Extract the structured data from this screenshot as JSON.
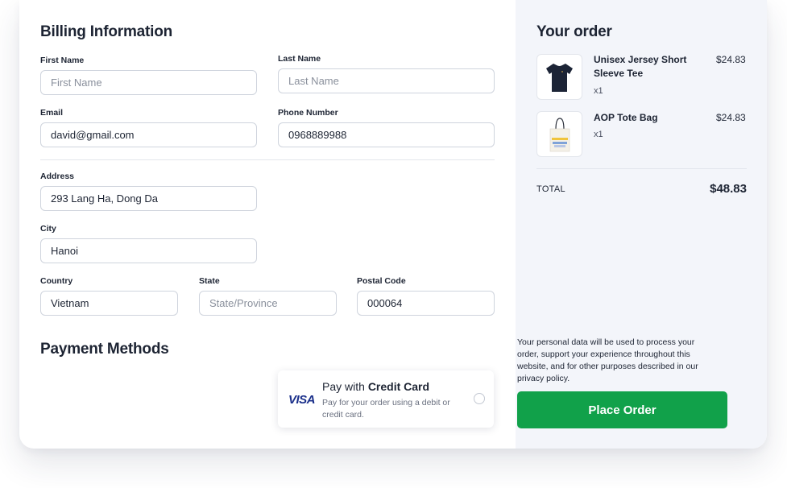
{
  "billing": {
    "title": "Billing Information",
    "first_name": {
      "label": "First Name",
      "value": "",
      "placeholder": "First Name"
    },
    "last_name": {
      "label": "Last Name",
      "value": "",
      "placeholder": "Last Name"
    },
    "email": {
      "label": "Email",
      "value": "david@gmail.com"
    },
    "phone": {
      "label": "Phone Number",
      "value": "0968889988"
    },
    "address": {
      "label": "Address",
      "value": "293 Lang Ha, Dong Da"
    },
    "city": {
      "label": "City",
      "value": "Hanoi"
    },
    "country": {
      "label": "Country",
      "value": "Vietnam"
    },
    "state": {
      "label": "State",
      "value": "",
      "placeholder": "State/Province"
    },
    "postal": {
      "label": "Postal Code",
      "value": "000064"
    }
  },
  "payment": {
    "title": "Payment Methods",
    "option": {
      "brand": "VISA",
      "title_prefix": "Pay with ",
      "title_bold": "Credit Card",
      "description": "Pay for your order using a debit or credit card.",
      "selected": false
    }
  },
  "order": {
    "title": "Your order",
    "items": [
      {
        "name": "Unisex Jersey Short Sleeve Tee",
        "qty": "x1",
        "price": "$24.83",
        "icon": "tshirt-icon"
      },
      {
        "name": "AOP Tote Bag",
        "qty": "x1",
        "price": "$24.83",
        "icon": "tote-bag-icon"
      }
    ],
    "total_label": "TOTAL",
    "total_value": "$48.83",
    "privacy_text": "Your personal data will be used to process your order, support your experience throughout this website, and for other purposes described in our privacy policy.",
    "place_order_label": "Place Order"
  },
  "colors": {
    "accent": "#11a14a",
    "panel_bg": "#f3f5fa",
    "visa_blue": "#1a2f8a"
  }
}
